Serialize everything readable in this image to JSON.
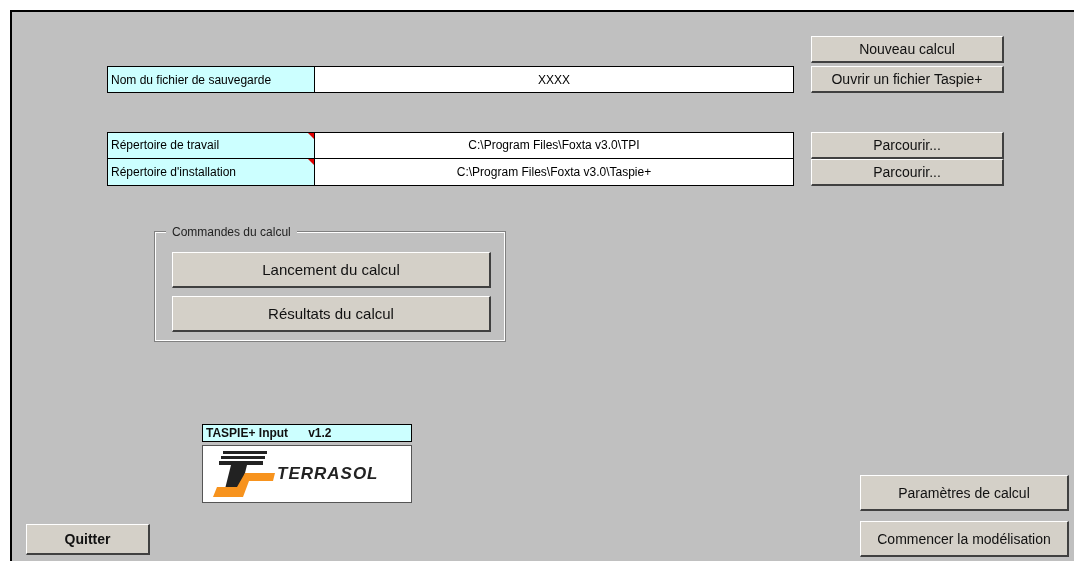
{
  "save_section": {
    "new_button": "Nouveau calcul",
    "field": {
      "label": "Nom du fichier de sauvegarde",
      "value": "XXXX",
      "comment": false
    },
    "open_button": "Ouvrir un fichier Taspie+"
  },
  "directories": [
    {
      "label": "Répertoire de travail",
      "value": "C:\\Program Files\\Foxta v3.0\\TPI",
      "comment": true,
      "button": "Parcourir..."
    },
    {
      "label": "Répertoire d'installation",
      "value": "C:\\Program Files\\Foxta v3.0\\Taspie+",
      "comment": true,
      "button": "Parcourir..."
    }
  ],
  "commands": {
    "title": "Commandes du calcul",
    "buttons": [
      "Lancement du calcul",
      "Résultats du calcul"
    ]
  },
  "version_label": {
    "name": "TASPIE+ Input",
    "version": "v1.2"
  },
  "logo": {
    "text": "TERRASOL"
  },
  "quit_button": "Quitter",
  "right_buttons": [
    "Paramètres de calcul",
    "Commencer la modélisation"
  ]
}
